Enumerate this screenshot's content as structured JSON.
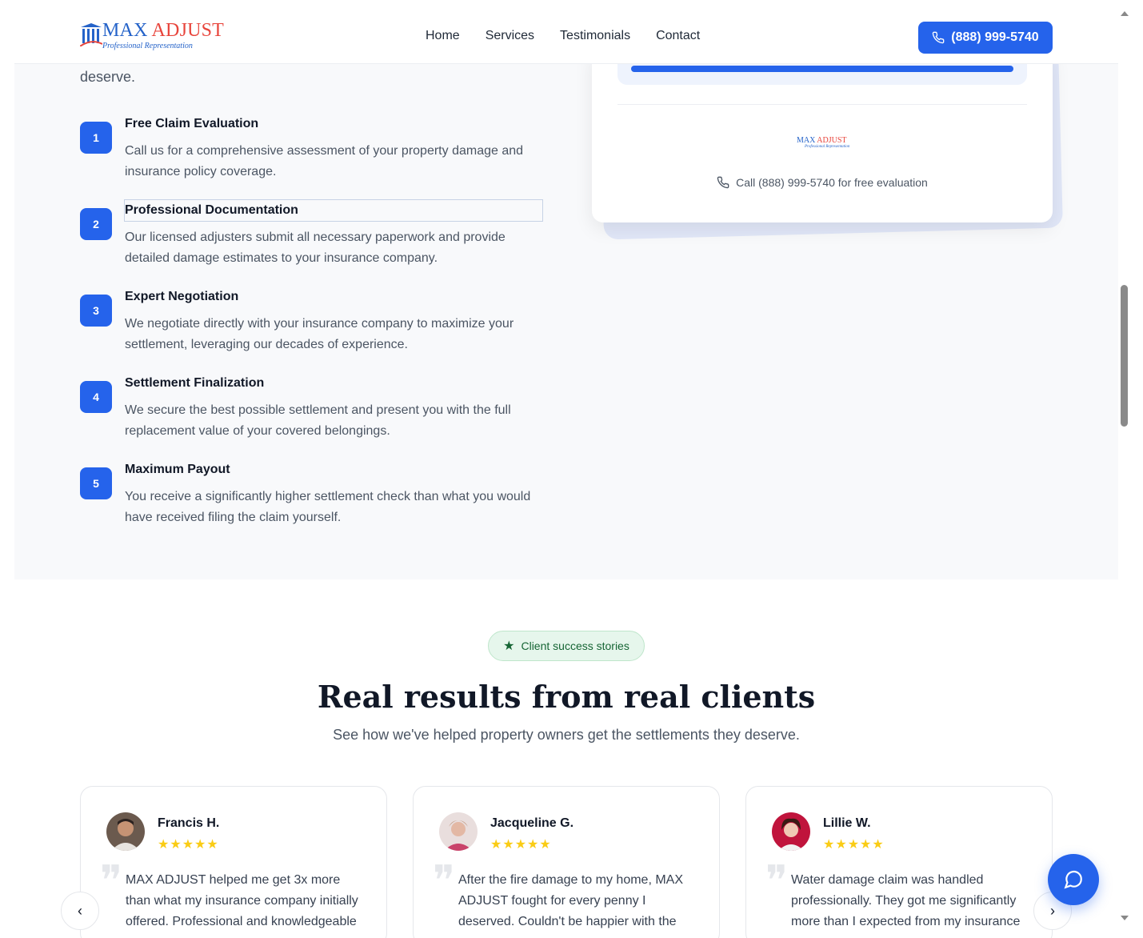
{
  "header": {
    "logo_name_part1": "MAX",
    "logo_name_part2": "ADJUST",
    "logo_tagline": "Professional Representation",
    "nav": [
      "Home",
      "Services",
      "Testimonials",
      "Contact"
    ],
    "phone_button": "(888) 999-5740"
  },
  "process": {
    "intro_tail": "deserve.",
    "steps": [
      {
        "num": "1",
        "title": "Free Claim Evaluation",
        "desc": "Call us for a comprehensive assessment of your property damage and insurance policy coverage."
      },
      {
        "num": "2",
        "title": "Professional Documentation",
        "desc": "Our licensed adjusters submit all necessary paperwork and provide detailed damage estimates to your insurance company."
      },
      {
        "num": "3",
        "title": "Expert Negotiation",
        "desc": "We negotiate directly with your insurance company to maximize your settlement, leveraging our decades of experience."
      },
      {
        "num": "4",
        "title": "Settlement Finalization",
        "desc": "We secure the best possible settlement and present you with the full replacement value of your covered belongings."
      },
      {
        "num": "5",
        "title": "Maximum Payout",
        "desc": "You receive a significantly higher settlement check than what you would have received filing the claim yourself."
      }
    ]
  },
  "side_card": {
    "call_text": "Call (888) 999-5740 for free evaluation",
    "progress": 1.0
  },
  "testimonials": {
    "badge": "Client success stories",
    "headline": "Real results from real clients",
    "subhead": "See how we've helped property owners get the settlements they deserve.",
    "items": [
      {
        "name": "Francis H.",
        "rating": 5,
        "stars": "★★★★★",
        "quote": "MAX ADJUST helped me get 3x more than what my insurance company initially offered. Professional and knowledgeable"
      },
      {
        "name": "Jacqueline G.",
        "rating": 5,
        "stars": "★★★★★",
        "quote": "After the fire damage to my home, MAX ADJUST fought for every penny I deserved. Couldn't be happier with the"
      },
      {
        "name": "Lillie W.",
        "rating": 5,
        "stars": "★★★★★",
        "quote": "Water damage claim was handled professionally. They got me significantly more than I expected from my insurance"
      }
    ],
    "prev_icon": "chevron-left-icon",
    "next_icon": "chevron-right-icon"
  },
  "colors": {
    "accent": "#2563eb",
    "logo_red": "#e8453c",
    "star": "#facc15",
    "badge_bg": "#e6f6ec",
    "badge_text": "#166534"
  }
}
